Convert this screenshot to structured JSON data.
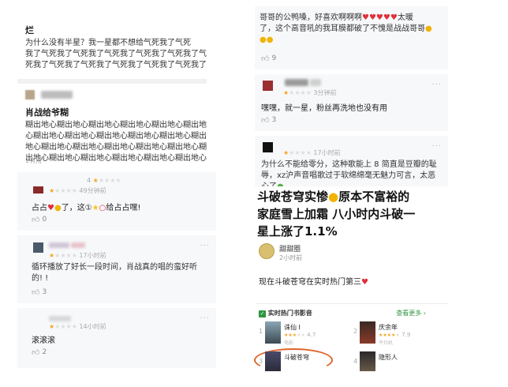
{
  "panel1": {
    "header_title": "烂",
    "header_lines": [
      "为什么没有半星？我一星都不想给气死我了气死",
      "我了气死我了气死我了气死我了气死我了气死我了气",
      "死我了气死我了气死我了气死我了气死我了气死我了"
    ],
    "comment_author": "肖战给爷糊",
    "comment_lines": [
      "糊出地心糊出地心糊出地心糊出地心糊出地心糊出地",
      "心糊出地心糊出地心糊出地心糊出地心糊出地心糊出",
      "地心糊出地心糊出地心糊出地心糊出地心糊出地心糊",
      "出地心糊出地心糊出地心糊出地心糊出地心糊出地心"
    ],
    "comment_likes": "1有用"
  },
  "panel2": {
    "top_meta": "4",
    "comment1_meta": "49分钟前",
    "comment1_text_a": "占占",
    "comment1_text_b": "了，这①",
    "comment1_text_c": "给占占嘿!",
    "comment1_likes": "0",
    "comment2_meta": "17小时前",
    "comment2_lines": [
      "循环播放了好长一段时间，肖战真的唱的蛮好听",
      "的! !"
    ],
    "comment2_likes": "3",
    "comment3_meta": "14小时前",
    "comment3_text": "滚滚滚",
    "comment3_likes": "2"
  },
  "panel3": {
    "top_lines_a": "哥哥的公鸭嗓，好喜欢啊啊啊",
    "top_lines_a_tail": "太暖",
    "top_lines_b": "了，这个高音吼的我耳膜都破了不愧是战战哥哥",
    "top_likes": "9",
    "comment1_meta": "3分钟前",
    "comment1_text": "嘿嘿，就一星，粉丝再洗地也没有用",
    "comment1_likes": "3",
    "comment2_meta": "17小时前",
    "comment2_lines": [
      "为什么不能给零分，这种歌能上 8 简直是豆瓣的耻",
      "辱，xz沪声音唱歌过于软绵绵毫无魅力可言，太恶",
      "心了"
    ]
  },
  "panel4": {
    "headline_a": "斗破苍穹实惨",
    "headline_b": "原本不富裕的",
    "headline_c": "家庭雪上加霜 八小时内斗破一",
    "headline_d": "星上涨了1.1%",
    "author": "甜甜圈",
    "time": "2小时前",
    "body": "现在斗破苍穹在实时热门第三",
    "ranking_title": "实时热门书影音",
    "ranking_more": "查看更多 ›",
    "items": [
      {
        "title": "诛仙 I",
        "rating": "4.7",
        "sub": "电影"
      },
      {
        "title": "庆余年",
        "rating": "7.9",
        "sub": "平均机"
      },
      {
        "title": "斗破苍穹",
        "rating": "",
        "sub": ""
      },
      {
        "title": "隐形人",
        "rating": "",
        "sub": ""
      }
    ]
  },
  "colors": {
    "star": "#f5a623",
    "heart": "#e0303a",
    "link": "#2e963d",
    "highlight": "#e0642a"
  },
  "icons": [
    "thumb-up-icon",
    "more-dots-icon",
    "heart-emoji",
    "laugh-cry-emoji",
    "star-emoji",
    "red-circle-emoji",
    "skull-emoji",
    "check-icon"
  ]
}
